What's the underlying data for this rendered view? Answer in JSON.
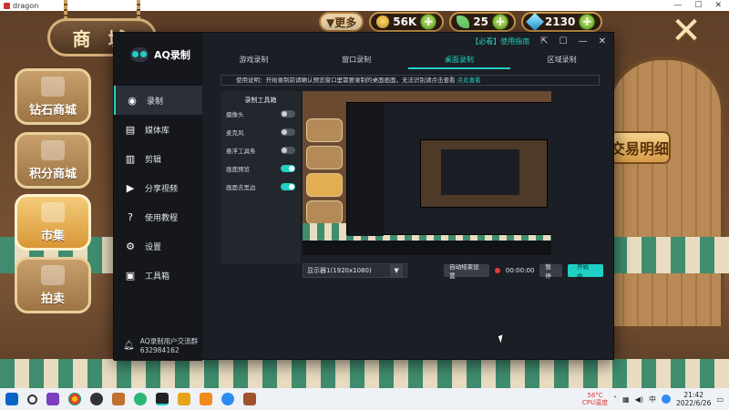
{
  "os_window": {
    "title": "dragon",
    "controls": [
      "—",
      "☐",
      "✕"
    ]
  },
  "game": {
    "shop_title": "商 城",
    "menu": [
      {
        "label": "钻石商城"
      },
      {
        "label": "积分商城"
      },
      {
        "label": "市集"
      },
      {
        "label": "拍卖"
      }
    ],
    "top": {
      "more": "▼更多",
      "coins": "56K",
      "leaves": "25",
      "gems": "2130"
    },
    "trade_sign": "交易明细"
  },
  "aq": {
    "app_name": "AQ录制",
    "top_link": "【必看】使用指南",
    "nav": [
      {
        "label": "录制",
        "icon": "record-icon"
      },
      {
        "label": "媒体库",
        "icon": "media-library-icon"
      },
      {
        "label": "剪辑",
        "icon": "edit-icon"
      },
      {
        "label": "分享视频",
        "icon": "share-video-icon"
      },
      {
        "label": "使用教程",
        "icon": "help-icon"
      },
      {
        "label": "设置",
        "icon": "gear-icon"
      },
      {
        "label": "工具箱",
        "icon": "toolbox-icon"
      }
    ],
    "tabs": [
      {
        "label": "游戏录制"
      },
      {
        "label": "窗口录制"
      },
      {
        "label": "桌面录制"
      },
      {
        "label": "区域录制"
      }
    ],
    "notice": "使用说明：开始录制前请确认预览窗口里需要录制的桌面画面，无法识别请点击查看",
    "notice_link": "点此查看",
    "tools_title": "录制工具箱",
    "tools": [
      {
        "label": "摄像头",
        "on": false
      },
      {
        "label": "麦克风",
        "on": false
      },
      {
        "label": "悬浮工具条",
        "on": false
      },
      {
        "label": "画面预览",
        "on": true
      },
      {
        "label": "画面去黑边",
        "on": true
      }
    ],
    "display_select": "显示器1(1920x1080)",
    "auto_end": "自动结束设置",
    "timer": "00:00:00",
    "pause": "暂停",
    "start": "开始中",
    "footer_line1": "AQ录制用户交流群",
    "footer_line2": "632984162"
  },
  "taskbar": {
    "temp_value": "56°C",
    "temp_label": "CPU温度",
    "ime": "中",
    "time": "21:42",
    "date": "2022/6/26"
  }
}
